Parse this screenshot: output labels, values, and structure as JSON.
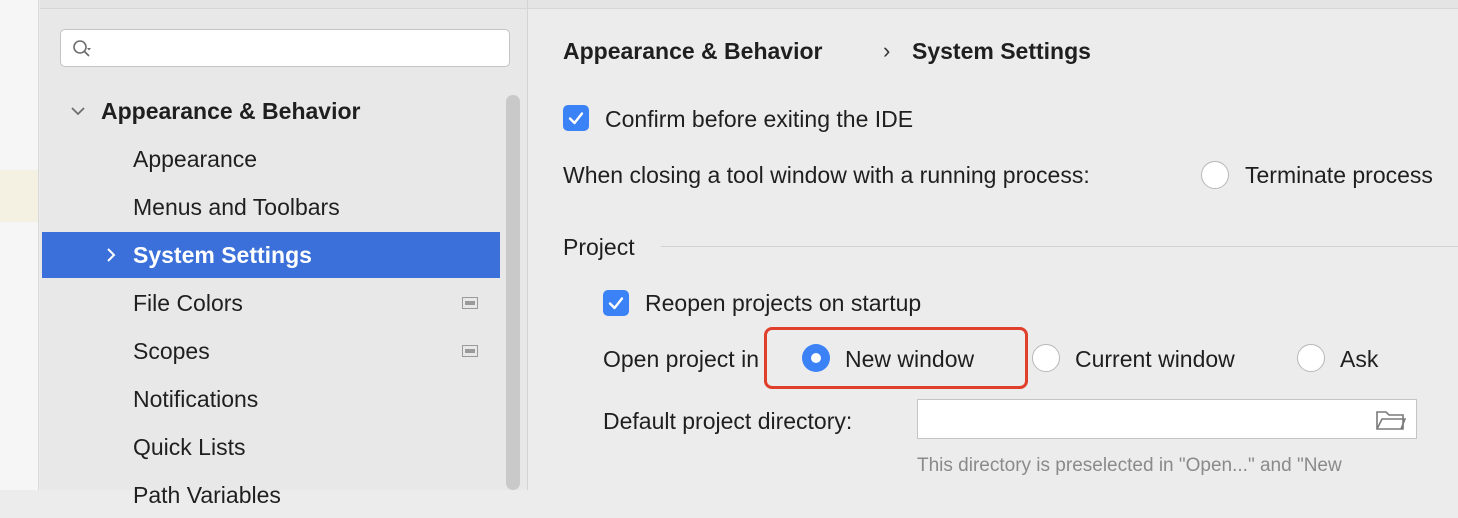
{
  "sidebar": {
    "search": {
      "placeholder": ""
    },
    "items": [
      {
        "label": "Appearance & Behavior",
        "expanded": true,
        "group": true
      },
      {
        "label": "Appearance"
      },
      {
        "label": "Menus and Toolbars"
      },
      {
        "label": "System Settings",
        "selected": true,
        "has_children": true
      },
      {
        "label": "File Colors",
        "badge_icon": "project-level-icon"
      },
      {
        "label": "Scopes",
        "badge_icon": "project-level-icon"
      },
      {
        "label": "Notifications"
      },
      {
        "label": "Quick Lists"
      },
      {
        "label": "Path Variables"
      }
    ]
  },
  "breadcrumb": {
    "parent": "Appearance & Behavior",
    "separator": "›",
    "current": "System Settings"
  },
  "settings": {
    "confirm_exit": {
      "label": "Confirm before exiting the IDE",
      "checked": true
    },
    "closing_tool_window": {
      "label": "When closing a tool window with a running process:",
      "option_label": "Terminate process",
      "selected": false
    },
    "project_section": {
      "title": "Project"
    },
    "reopen_projects": {
      "label": "Reopen projects on startup",
      "checked": true
    },
    "open_project_in": {
      "label": "Open project in",
      "options": [
        {
          "label": "New window",
          "selected": true
        },
        {
          "label": "Current window",
          "selected": false
        },
        {
          "label": "Ask",
          "selected": false
        }
      ]
    },
    "default_directory": {
      "label": "Default project directory:",
      "value": "",
      "hint": "This directory is preselected in \"Open...\" and \"New"
    }
  },
  "colors": {
    "accent": "#3b82f6",
    "selection": "#3b6fd9",
    "annotation": "#e0402b"
  }
}
